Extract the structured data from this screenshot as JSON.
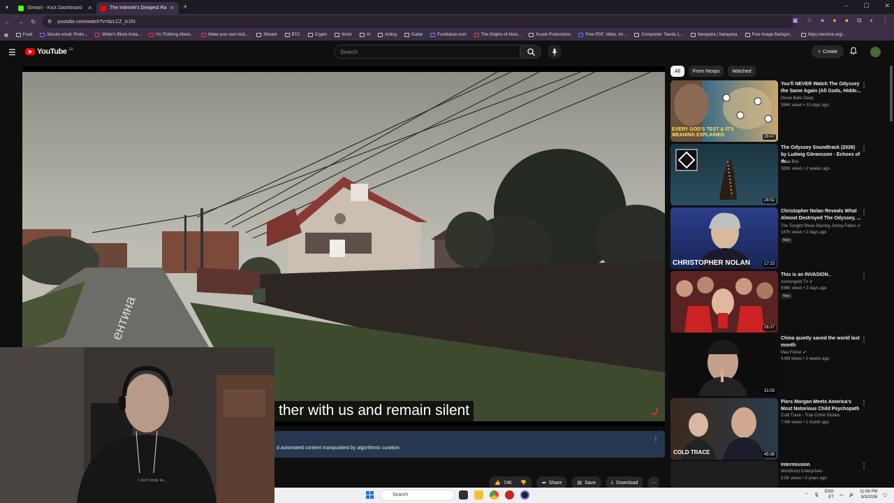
{
  "browser": {
    "tabs": [
      {
        "title": "Stream - Kick Dashboard",
        "favicon_color": "#53fc18",
        "active": false
      },
      {
        "title": "The Internet's Deepest Rab...",
        "favicon_color": "#ff0000",
        "active": true
      }
    ],
    "new_tab": "+",
    "url": "youtube.com/watch?v=6zLCZ_Ic1hI",
    "window_controls": [
      "–",
      "☐",
      "✕"
    ],
    "bookmarks": [
      "Food",
      "Secure email: Proto...",
      "Writer's Block Insta...",
      "I'm Thinking About...",
      "Make your own luck...",
      "Stream",
      "BTC",
      "Crypto",
      "Nostr",
      "AI",
      "Acting",
      "Guitar",
      "Fundraiser.com",
      "The Origins of Akira...",
      "Kuusk Productions",
      "Free PDF, Video, Im...",
      "Composite: Tavola 1...",
      "Narayana | Narayana",
      "Free Image Backgro...",
      "https://archive.org/..."
    ]
  },
  "header": {
    "menu_icon": "☰",
    "logo_text": "YouTube",
    "country_code": "EE",
    "search_placeholder": "Search",
    "search_icon": "⌕",
    "mic_icon": "🎤",
    "create_label": "Create",
    "create_icon": "+",
    "bell_icon": "🔔"
  },
  "player": {
    "caption": "ther with us and remain silent"
  },
  "info": {
    "text": "d automated content manipulated by algorithmic curation.",
    "more": "⋮"
  },
  "actions": {
    "likes": "74K",
    "like_icon": "👍",
    "dislike_icon": "👎",
    "share": "Share",
    "save": "Save",
    "download": "Download",
    "more": "⋯"
  },
  "sidebar": {
    "chips": [
      "All",
      "From Nexpo",
      "Watched"
    ],
    "recommendations": [
      {
        "title": "You'll NEVER Watch The Odyssey the Same Again (All Gods, Hidde...",
        "channel": "Movie Balls Deep",
        "meta": "394K views • 10 days ago",
        "duration": "28:47",
        "thumb_text": "EVERY GOD'S TEST & IT'S MEANING EXPLAINED",
        "verified": false,
        "new": false
      },
      {
        "title": "The Odyssey Soundtrack (2026) by Ludwig Göransson - Echoes of th...",
        "channel": "Kaka Box",
        "meta": "383K views • 2 weeks ago",
        "duration": "28:52",
        "thumb_text": "",
        "verified": false,
        "new": false
      },
      {
        "title": "Christopher Nolan Reveals What Almost Destroyed The Odyssey, ...",
        "channel": "The Tonight Show Starring Jimmy Fallon",
        "meta": "187K views • 2 days ago",
        "duration": "17:23",
        "thumb_text": "CHRISTOPHER NOLAN",
        "verified": true,
        "new": true
      },
      {
        "title": "This is an INVASION..",
        "channel": "Asmongold TV",
        "meta": "936K views • 2 days ago",
        "duration": "26:37",
        "thumb_text": "",
        "verified": true,
        "new": true
      },
      {
        "title": "China quietly saved the world last month",
        "channel": "Max Fisher",
        "meta": "4.9M views • 2 weeks ago",
        "duration": "31:03",
        "thumb_text": "",
        "verified": true,
        "new": false
      },
      {
        "title": "Piers Morgan Meets America's Most Notorious Child Psychopath",
        "channel": "Cold Trace - True Crime Stories",
        "meta": "7.4M views • 1 month ago",
        "duration": "45:38",
        "thumb_text": "COLD TRACE",
        "verified": false,
        "new": false
      },
      {
        "title": "Intermission",
        "channel": "Worldcorp Enterprises",
        "meta": "3.5K views • 5 years ago",
        "duration": "",
        "thumb_text": "",
        "verified": false,
        "new": false
      }
    ],
    "new_badge": "New",
    "more": "⋮"
  },
  "taskbar": {
    "search_label": "Search",
    "lang_top": "ENG",
    "lang_bottom": "ET",
    "time": "11:08 PM",
    "date": "8/3/2026"
  },
  "webcam": {
    "shirt_text": "I don't think he..."
  }
}
